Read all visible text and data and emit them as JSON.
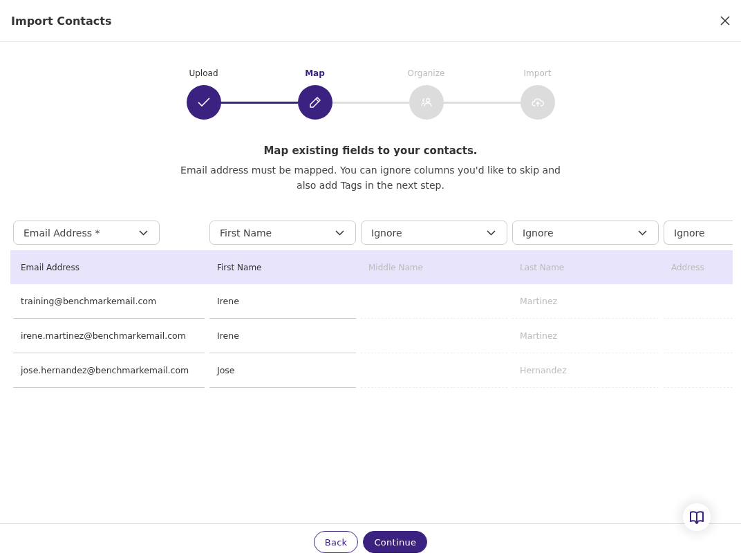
{
  "dialog": {
    "title": "Import Contacts"
  },
  "steps": [
    {
      "label": "Upload",
      "completed": true,
      "selected": false
    },
    {
      "label": "Map",
      "completed": false,
      "selected": true
    },
    {
      "label": "Organize",
      "completed": false,
      "selected": false
    },
    {
      "label": "Import",
      "completed": false,
      "selected": false
    }
  ],
  "heading": "Map existing fields to your contacts.",
  "description": "Email address must be mapped. You can ignore columns you'd like to skip and also add Tags in the next step.",
  "table": {
    "columns": [
      {
        "mapping": "Email Address *",
        "header": "Email Address",
        "ignored": false
      },
      {
        "mapping": "First Name",
        "header": "First Name",
        "ignored": false
      },
      {
        "mapping": "Ignore",
        "header": "Middle Name",
        "ignored": true
      },
      {
        "mapping": "Ignore",
        "header": "Last Name",
        "ignored": true
      },
      {
        "mapping": "Ignore",
        "header": "Address",
        "ignored": true
      }
    ],
    "rows": [
      {
        "cells": [
          {
            "text": "training@benchmarkemail.com"
          },
          {
            "text": "Irene"
          },
          {},
          {
            "text": "Martinez"
          },
          {}
        ]
      },
      {
        "cells": [
          {
            "text": "irene.martinez@benchmarkemail.com"
          },
          {
            "text": "Irene"
          },
          {},
          {
            "text": "Martinez"
          },
          {}
        ]
      },
      {
        "cells": [
          {
            "text": "jose.hernandez@benchmarkemail.com"
          },
          {
            "text": "Jose"
          },
          {},
          {
            "text": "Hernandez"
          },
          {}
        ]
      }
    ]
  },
  "buttons": [
    {
      "label": "Back",
      "kind": "secondary"
    },
    {
      "label": "Continue",
      "kind": "primary"
    }
  ]
}
